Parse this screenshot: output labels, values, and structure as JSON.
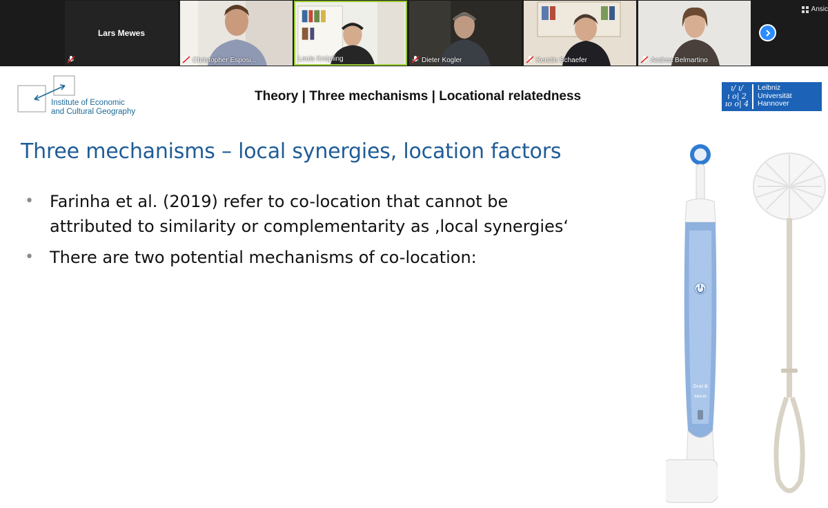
{
  "participants_strip": {
    "view_label": "Ansic",
    "tiles": [
      {
        "name": "Lars Mewes",
        "muted": true
      },
      {
        "name": "Christopher Esposi...",
        "muted": true
      },
      {
        "name": "Louis Knüpling",
        "muted": false
      },
      {
        "name": "Dieter Kogler",
        "muted": true
      },
      {
        "name": "Kerstin Schaefer",
        "muted": true
      },
      {
        "name": "Andrea Belmartino",
        "muted": true
      }
    ],
    "next_icon": "chevron-right-icon"
  },
  "slide": {
    "institute_line1": "Institute of Economic",
    "institute_line2": "and Cultural Geography",
    "header_title": "Theory | Three mechanisms | Locational relatedness",
    "university": {
      "mark_line1": "ı/ ı/",
      "mark_line2": "ı o| 2",
      "mark_line3": "ıo o| 4",
      "name_line1": "Leibniz",
      "name_line2": "Universität",
      "name_line3": "Hannover"
    },
    "heading": "Three mechanisms – local synergies, location factors",
    "bullets": [
      "Farinha et al. (2019) refer to co-location that cannot be attributed to similarity or complementarity as ‚local synergies‘",
      "There are two potential mechanisms of co-location:"
    ],
    "brush_brand_line1": "Oral-B",
    "brush_brand_line2": "BRAUN"
  },
  "colors": {
    "accent_blue": "#1f5c96",
    "university_blue": "#1c62b6",
    "active_speaker": "#9acd32",
    "next_button": "#2d8cff"
  }
}
